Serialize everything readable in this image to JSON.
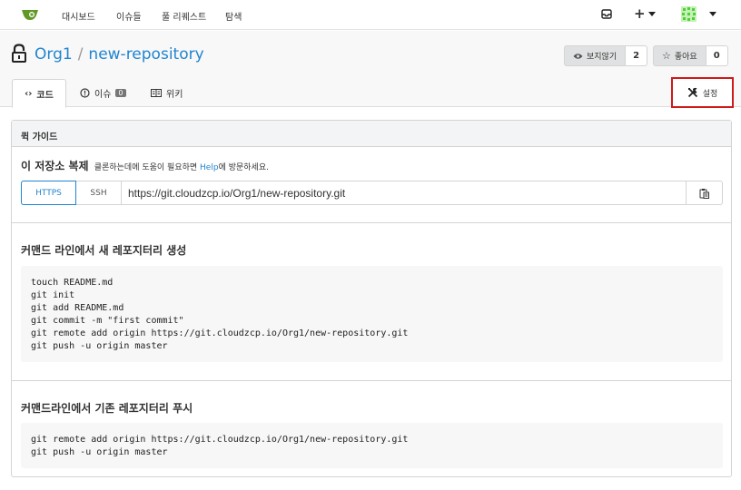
{
  "nav": {
    "items": [
      "대시보드",
      "이슈들",
      "풀 리퀘스트",
      "탐색"
    ]
  },
  "repo": {
    "owner": "Org1",
    "separator": "/",
    "name": "new-repository"
  },
  "actions": {
    "watch_label": "보지않기",
    "watch_count": "2",
    "star_label": "좋아요",
    "star_count": "0"
  },
  "tabs": {
    "code": "코드",
    "issues": "이슈",
    "issues_count": "0",
    "wiki": "위키",
    "settings": "설정"
  },
  "guide": {
    "title": "퀵 가이드",
    "clone_heading": "이 저장소 복제",
    "clone_hint_pre": "클론하는데에 도움이 필요하면 ",
    "clone_hint_link": "Help",
    "clone_hint_post": "에 방문하세요.",
    "https_label": "HTTPS",
    "ssh_label": "SSH",
    "clone_url": "https://git.cloudzcp.io/Org1/new-repository.git",
    "new_heading": "커맨드 라인에서 새 레포지터리 생성",
    "new_code": "touch README.md\ngit init\ngit add README.md\ngit commit -m \"first commit\"\ngit remote add origin https://git.cloudzcp.io/Org1/new-repository.git\ngit push -u origin master",
    "push_heading": "커맨드라인에서 기존 레포지터리 푸시",
    "push_code": "git remote add origin https://git.cloudzcp.io/Org1/new-repository.git\ngit push -u origin master"
  },
  "colors": {
    "accent": "#2185d0",
    "logo": "#609926",
    "highlight_border": "#d01919"
  }
}
